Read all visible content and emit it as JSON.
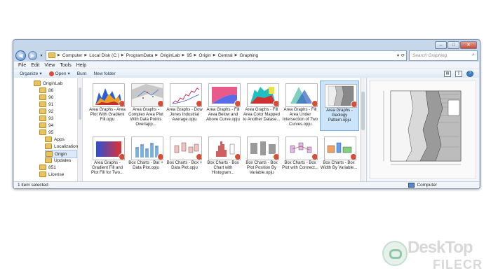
{
  "address_bar": {
    "crumbs": [
      "Computer",
      "Local Disk (C:)",
      "ProgramData",
      "OriginLab",
      "95",
      "Origin",
      "Central",
      "Graphing"
    ]
  },
  "search": {
    "placeholder": "Search Graphing"
  },
  "menu": [
    "File",
    "Edit",
    "View",
    "Tools",
    "Help"
  ],
  "toolbar": {
    "organize": "Organize",
    "open": "Open",
    "burn": "Burn",
    "new_folder": "New folder"
  },
  "nav_items": [
    {
      "label": "OriginLab",
      "level": 1
    },
    {
      "label": "86",
      "level": 2
    },
    {
      "label": "90",
      "level": 2
    },
    {
      "label": "91",
      "level": 2
    },
    {
      "label": "92",
      "level": 2
    },
    {
      "label": "93",
      "level": 2
    },
    {
      "label": "94",
      "level": 2
    },
    {
      "label": "95",
      "level": 2
    },
    {
      "label": "Apps",
      "level": 3
    },
    {
      "label": "Localization",
      "level": 3
    },
    {
      "label": "Origin",
      "level": 3,
      "selected": true
    },
    {
      "label": "Updates",
      "level": 3
    },
    {
      "label": "851",
      "level": 2
    },
    {
      "label": "License",
      "level": 2
    }
  ],
  "files": [
    {
      "label": "Area Graphs - Area Plot With Gradient Fill.opju",
      "thumb": "area"
    },
    {
      "label": "Area Graphs - Complex Area Plot With Data Points Overlapp...",
      "thumb": "complex"
    },
    {
      "label": "Area Graphs - Dow Jones Industrial Average.opju",
      "thumb": "dow"
    },
    {
      "label": "Area Graphs - Fill Area Below and Above Curve.opju",
      "thumb": "fillarea"
    },
    {
      "label": "Area Graphs - Fill Area Color Mapped to Another Datase...",
      "thumb": "colormap"
    },
    {
      "label": "Area Graphs - Fill Area Under Intersection of Two Curves.opju",
      "thumb": "intersect"
    },
    {
      "label": "Area Graphs - Geology Pattern.opju",
      "thumb": "geology",
      "selected": true
    },
    {
      "label": "Area Graphs - Gradient Fill and Plot Fill for Two...",
      "thumb": "gradient"
    },
    {
      "label": "Box Charts - Bar + Data Plot.opju",
      "thumb": "bar"
    },
    {
      "label": "Box Charts - Box + Data Plot.opju",
      "thumb": "box"
    },
    {
      "label": "Box Charts - Box Chart with Histogram...",
      "thumb": "hist"
    },
    {
      "label": "Box Charts - Box Plot Position By Variable.opju",
      "thumb": "boxpos"
    },
    {
      "label": "Box Charts - Box Plot with Connect...",
      "thumb": "boxconn"
    },
    {
      "label": "Box Charts - Box Width By Variable...",
      "thumb": "boxwidth"
    }
  ],
  "status": {
    "selection": "1 item selected",
    "location": "Computer"
  },
  "watermark": {
    "line1": "DeskTop",
    "line2": "FILECR"
  },
  "colors": {
    "accent": "#3c7fc8",
    "selection": "#cce4f9",
    "folder": "#e8c35f"
  }
}
